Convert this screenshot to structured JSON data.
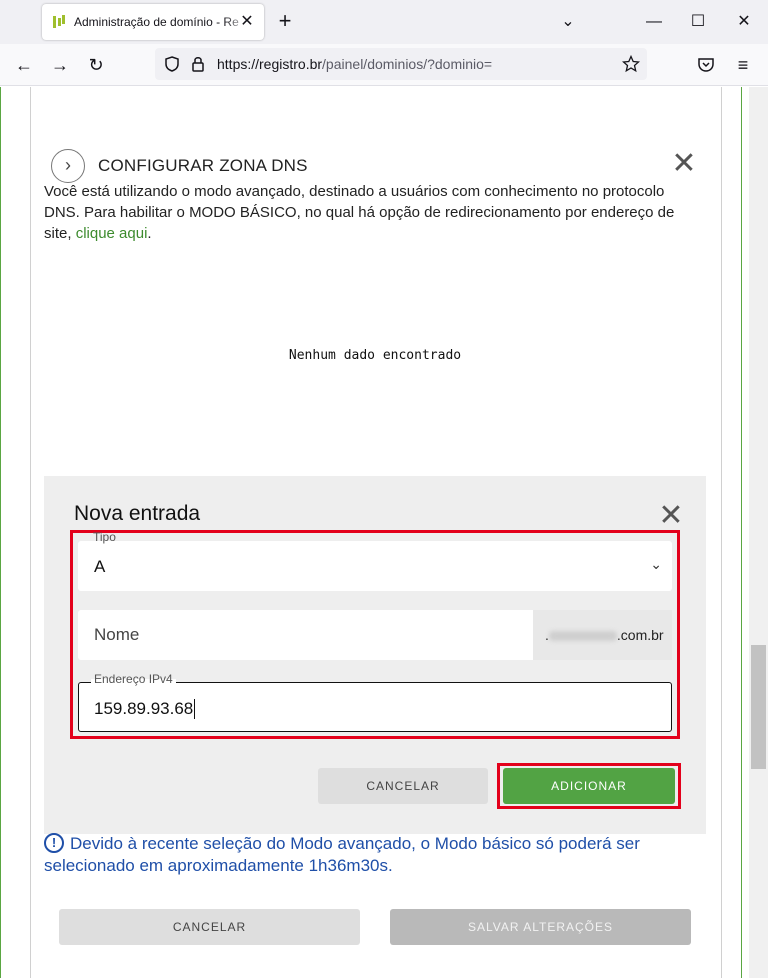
{
  "browser": {
    "tab_title": "Administração de domínio - Re",
    "url_host": "https://registro.br",
    "url_path": "/painel/dominios/?dominio="
  },
  "dns": {
    "section_title": "CONFIGURAR ZONA DNS",
    "intro_text": "Você está utilizando o modo avançado, destinado a usuários com conhecimento no protocolo DNS. Para habilitar o MODO BÁSICO, no qual há opção de redirecionamento por endereço de site, ",
    "intro_link": "clique aqui",
    "intro_end": ".",
    "empty_message": "Nenhum dado encontrado"
  },
  "new_entry": {
    "title": "Nova entrada",
    "tipo_label": "Tipo",
    "tipo_value": "A",
    "nome_placeholder": "Nome",
    "domain_suffix": ".com.br",
    "ipv4_label": "Endereço IPv4",
    "ipv4_value": "159.89.93.68",
    "cancel_label": "CANCELAR",
    "add_label": "ADICIONAR"
  },
  "warning": {
    "text": "Devido à recente seleção do Modo avançado, o Modo básico só poderá ser selecionado em aproximadamente 1h36m30s."
  },
  "footer": {
    "cancel_label": "CANCELAR",
    "save_label": "SALVAR ALTERAÇÕES"
  }
}
